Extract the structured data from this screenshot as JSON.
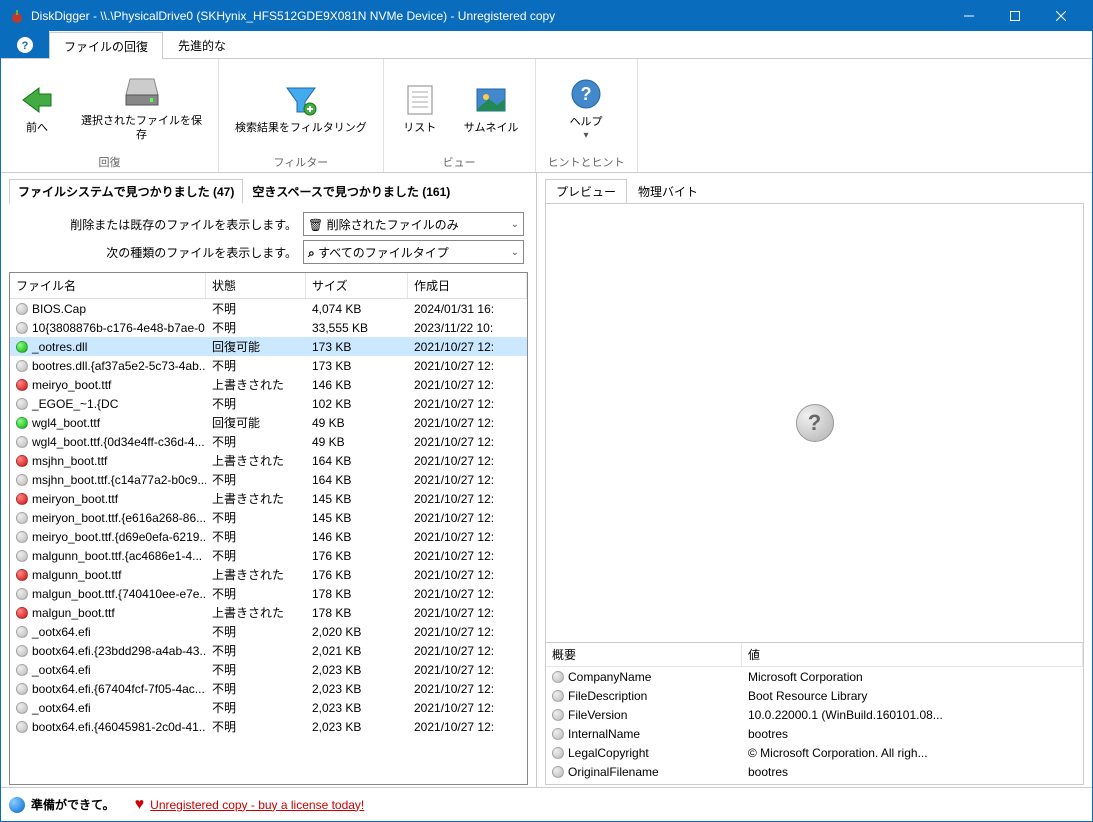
{
  "titlebar": {
    "text": "DiskDigger - \\\\.\\PhysicalDrive0 (SKHynix_HFS512GDE9X081N NVMe Device) - Unregistered copy"
  },
  "menutabs": {
    "recovery": "ファイルの回復",
    "advanced": "先進的な"
  },
  "ribbon": {
    "back": "前へ",
    "save_selected": "選択されたファイルを保\n存",
    "group_recovery": "回復",
    "filter_results": "検索結果をフィルタリング",
    "group_filter": "フィルター",
    "list_view": "リスト",
    "thumbnail_view": "サムネイル",
    "group_view": "ビュー",
    "help": "ヘルプ",
    "group_hints": "ヒントとヒント"
  },
  "subtabs": {
    "found_in_fs": "ファイルシステムで見つかりました (47)",
    "found_in_free": "空きスペースで見つかりました (161)"
  },
  "filters": {
    "label_show_deleted": "削除または既存のファイルを表示します。",
    "value_deleted_only": "削除されたファイルのみ",
    "label_show_types": "次の種類のファイルを表示します。",
    "value_all_types": "すべてのファイルタイプ"
  },
  "columns": {
    "name": "ファイル名",
    "status": "状態",
    "size": "サイズ",
    "date": "作成日"
  },
  "status_labels": {
    "unknown": "不明",
    "recoverable": "回復可能",
    "overwritten": "上書きされた"
  },
  "files": [
    {
      "dot": "gray",
      "name": "BIOS.Cap",
      "status": "unknown",
      "size": "4,074 KB",
      "date": "2024/01/31 16:"
    },
    {
      "dot": "gray",
      "name": "10{3808876b-c176-4e48-b7ae-0...",
      "status": "unknown",
      "size": "33,555 KB",
      "date": "2023/11/22 10:"
    },
    {
      "dot": "green",
      "name": "_ootres.dll",
      "status": "recoverable",
      "size": "173 KB",
      "date": "2021/10/27 12:",
      "selected": true
    },
    {
      "dot": "gray",
      "name": "bootres.dll.{af37a5e2-5c73-4ab...",
      "status": "unknown",
      "size": "173 KB",
      "date": "2021/10/27 12:"
    },
    {
      "dot": "red",
      "name": "meiryo_boot.ttf",
      "status": "overwritten",
      "size": "146 KB",
      "date": "2021/10/27 12:"
    },
    {
      "dot": "gray",
      "name": "_EGOE_~1.{DC",
      "status": "unknown",
      "size": "102 KB",
      "date": "2021/10/27 12:"
    },
    {
      "dot": "green",
      "name": "wgl4_boot.ttf",
      "status": "recoverable",
      "size": "49 KB",
      "date": "2021/10/27 12:"
    },
    {
      "dot": "gray",
      "name": "wgl4_boot.ttf.{0d34e4ff-c36d-4...",
      "status": "unknown",
      "size": "49 KB",
      "date": "2021/10/27 12:"
    },
    {
      "dot": "red",
      "name": "msjhn_boot.ttf",
      "status": "overwritten",
      "size": "164 KB",
      "date": "2021/10/27 12:"
    },
    {
      "dot": "gray",
      "name": "msjhn_boot.ttf.{c14a77a2-b0c9...",
      "status": "unknown",
      "size": "164 KB",
      "date": "2021/10/27 12:"
    },
    {
      "dot": "red",
      "name": "meiryon_boot.ttf",
      "status": "overwritten",
      "size": "145 KB",
      "date": "2021/10/27 12:"
    },
    {
      "dot": "gray",
      "name": "meiryon_boot.ttf.{e616a268-86...",
      "status": "unknown",
      "size": "145 KB",
      "date": "2021/10/27 12:"
    },
    {
      "dot": "gray",
      "name": "meiryo_boot.ttf.{d69e0efa-6219...",
      "status": "unknown",
      "size": "146 KB",
      "date": "2021/10/27 12:"
    },
    {
      "dot": "gray",
      "name": "malgunn_boot.ttf.{ac4686e1-4...",
      "status": "unknown",
      "size": "176 KB",
      "date": "2021/10/27 12:"
    },
    {
      "dot": "red",
      "name": "malgunn_boot.ttf",
      "status": "overwritten",
      "size": "176 KB",
      "date": "2021/10/27 12:"
    },
    {
      "dot": "gray",
      "name": "malgun_boot.ttf.{740410ee-e7e...",
      "status": "unknown",
      "size": "178 KB",
      "date": "2021/10/27 12:"
    },
    {
      "dot": "red",
      "name": "malgun_boot.ttf",
      "status": "overwritten",
      "size": "178 KB",
      "date": "2021/10/27 12:"
    },
    {
      "dot": "gray",
      "name": "_ootx64.efi",
      "status": "unknown",
      "size": "2,020 KB",
      "date": "2021/10/27 12:"
    },
    {
      "dot": "gray",
      "name": "bootx64.efi.{23bdd298-a4ab-43...",
      "status": "unknown",
      "size": "2,021 KB",
      "date": "2021/10/27 12:"
    },
    {
      "dot": "gray",
      "name": "_ootx64.efi",
      "status": "unknown",
      "size": "2,023 KB",
      "date": "2021/10/27 12:"
    },
    {
      "dot": "gray",
      "name": "bootx64.efi.{67404fcf-7f05-4ac...",
      "status": "unknown",
      "size": "2,023 KB",
      "date": "2021/10/27 12:"
    },
    {
      "dot": "gray",
      "name": "_ootx64.efi",
      "status": "unknown",
      "size": "2,023 KB",
      "date": "2021/10/27 12:"
    },
    {
      "dot": "gray",
      "name": "bootx64.efi.{46045981-2c0d-41...",
      "status": "unknown",
      "size": "2,023 KB",
      "date": "2021/10/27 12:"
    }
  ],
  "preview_tabs": {
    "preview": "プレビュー",
    "bytes": "物理バイト"
  },
  "meta_columns": {
    "key": "概要",
    "value": "値"
  },
  "metadata": [
    {
      "key": "CompanyName",
      "value": "Microsoft Corporation"
    },
    {
      "key": "FileDescription",
      "value": "Boot Resource Library"
    },
    {
      "key": "FileVersion",
      "value": "10.0.22000.1 (WinBuild.160101.08..."
    },
    {
      "key": "InternalName",
      "value": "bootres"
    },
    {
      "key": "LegalCopyright",
      "value": "© Microsoft Corporation. All righ..."
    },
    {
      "key": "OriginalFilename",
      "value": "bootres"
    }
  ],
  "statusbar": {
    "ready": "準備ができて。",
    "license_link": "Unregistered copy - buy a license today!"
  }
}
